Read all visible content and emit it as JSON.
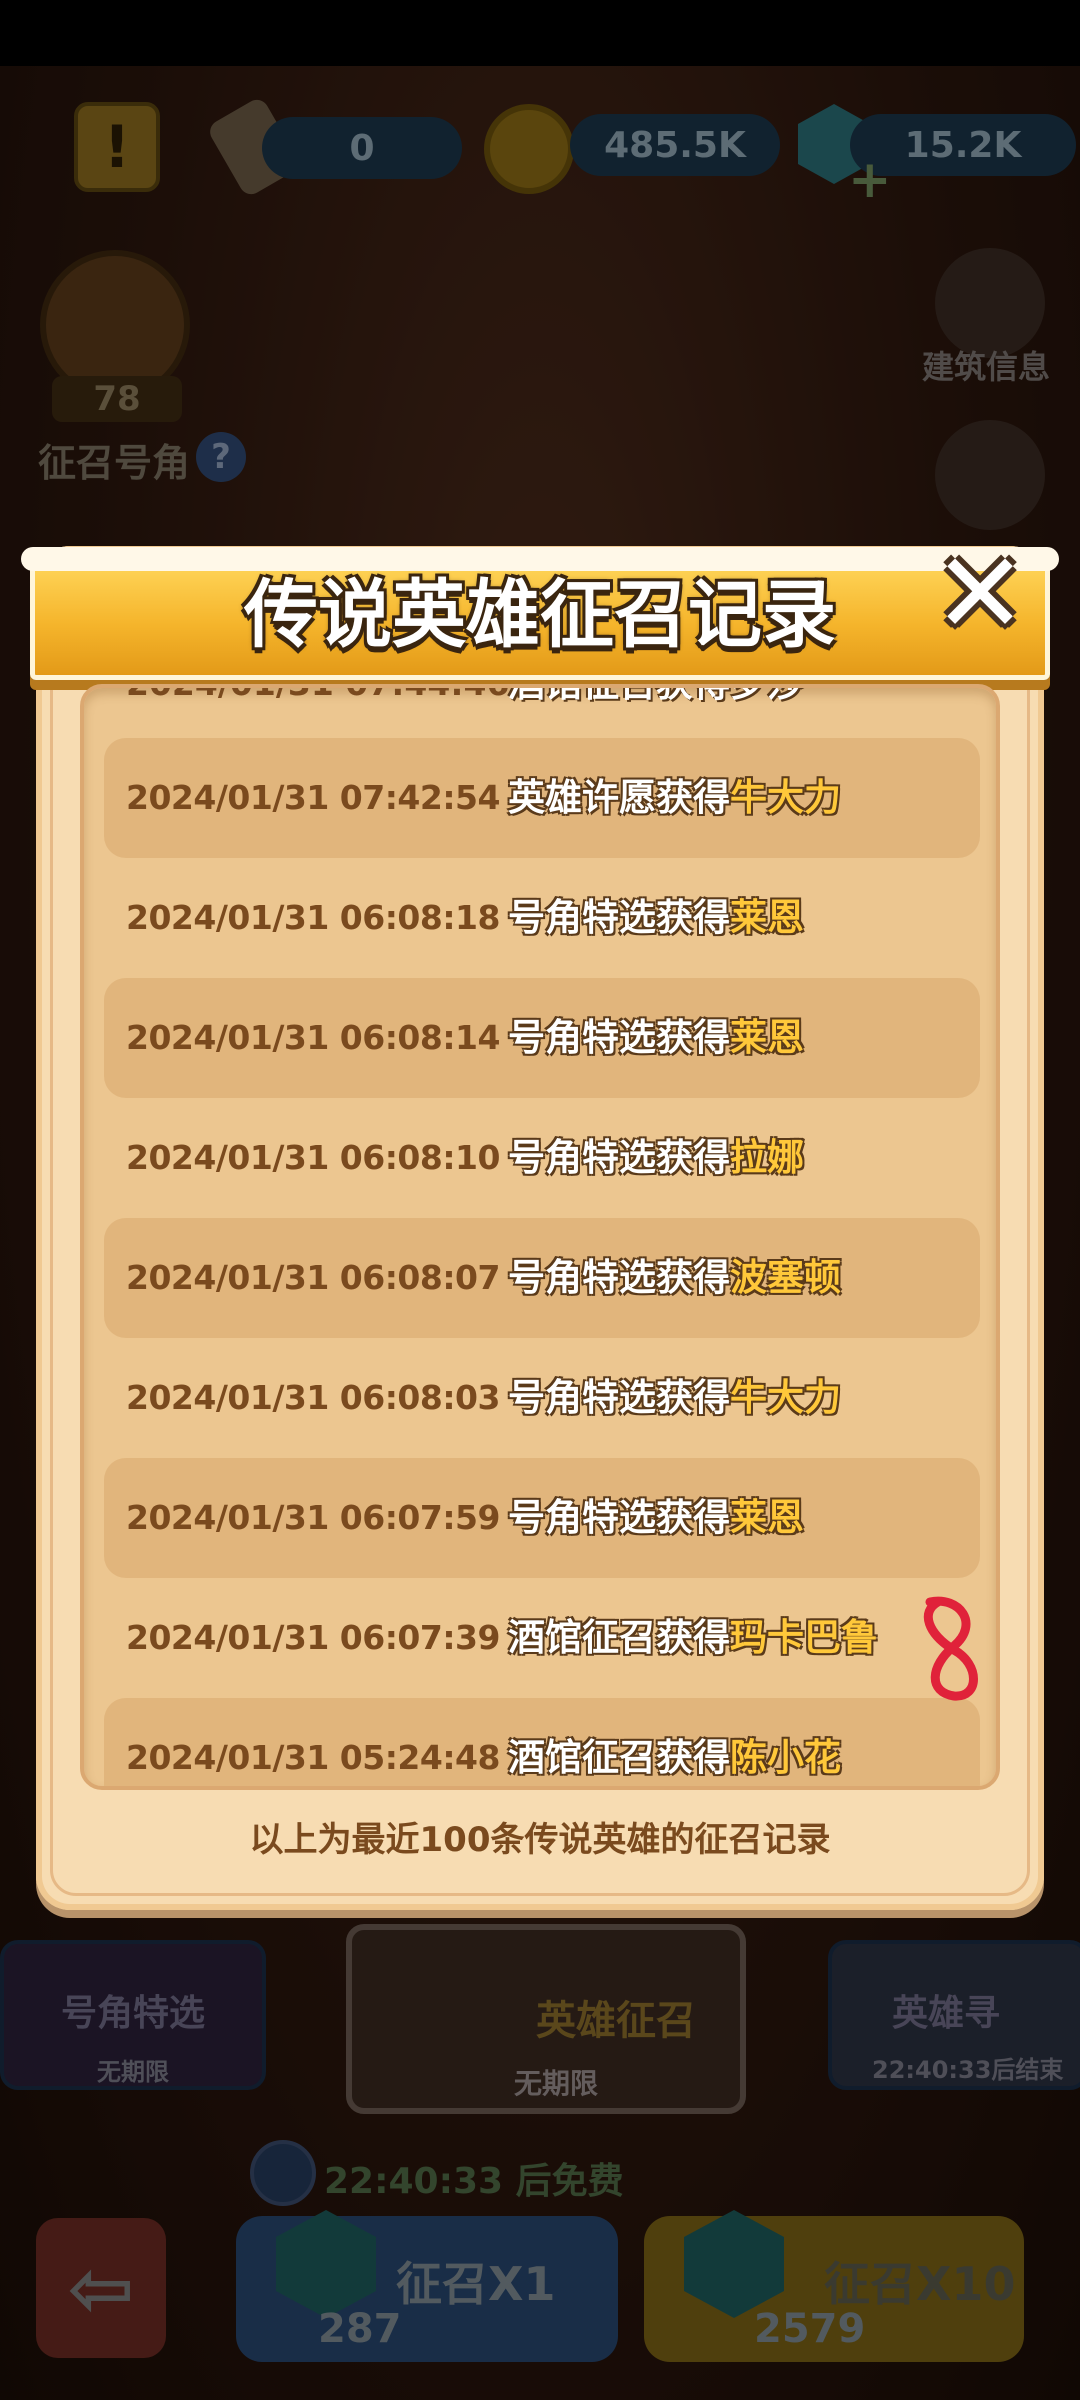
{
  "top_bar": {
    "scroll_count": "0",
    "gold": "485.5K",
    "gems": "15.2K"
  },
  "left_panel": {
    "horn_count": "78",
    "horn_label": "征召号角",
    "help_glyph": "?"
  },
  "right_panel": {
    "building_info_label": "建筑信息"
  },
  "modal": {
    "title": "传说英雄征召记录",
    "close_glyph": "✕",
    "records": [
      {
        "date": "2024/01/31 07:42:54",
        "action": "英雄许愿获得",
        "hero": "牛大力"
      },
      {
        "date": "2024/01/31 06:08:18",
        "action": "号角特选获得",
        "hero": "莱恩"
      },
      {
        "date": "2024/01/31 06:08:14",
        "action": "号角特选获得",
        "hero": "莱恩"
      },
      {
        "date": "2024/01/31 06:08:10",
        "action": "号角特选获得",
        "hero": "拉娜"
      },
      {
        "date": "2024/01/31 06:08:07",
        "action": "号角特选获得",
        "hero": "波塞顿"
      },
      {
        "date": "2024/01/31 06:08:03",
        "action": "号角特选获得",
        "hero": "牛大力"
      },
      {
        "date": "2024/01/31 06:07:59",
        "action": "号角特选获得",
        "hero": "莱恩"
      },
      {
        "date": "2024/01/31 06:07:39",
        "action": "酒馆征召获得",
        "hero": "玛卡巴鲁"
      },
      {
        "date": "2024/01/31 05:24:48",
        "action": "酒馆征召获得",
        "hero": "陈小花"
      }
    ],
    "footer": "以上为最近100条传说英雄的征召记录"
  },
  "bottom_tabs": {
    "horn_select_title": "号角特选",
    "horn_select_sub": "无期限",
    "hero_recruit_title": "英雄征召",
    "hero_recruit_sub": "无期限",
    "hero_seek_title": "英雄寻",
    "hero_seek_sub": "22:40:33后结束"
  },
  "bottom_bar": {
    "free_timer": "22:40:33 后免费",
    "back_glyph": "⇦",
    "summon_x1_label": "征召X1",
    "summon_x1_cost": "287",
    "summon_x10_label": "征召X10",
    "summon_x10_cost": "2579"
  },
  "colors": {
    "banner": "#f5b52c",
    "hero_name": "#ffc83a",
    "panel": "#f7dcb2",
    "row_shaded": "#e1b57c"
  }
}
